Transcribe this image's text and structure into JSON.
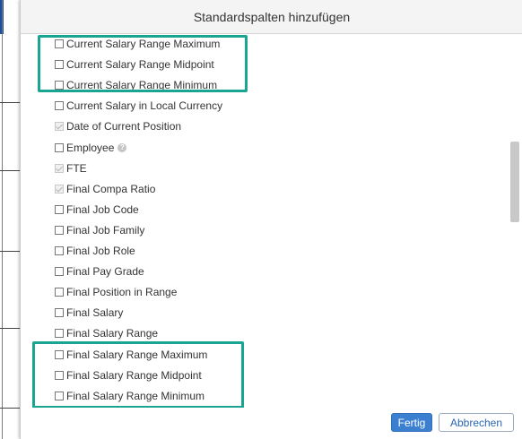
{
  "dialog": {
    "title": "Standardspalten hinzufügen"
  },
  "items": [
    {
      "label": "Current Salary Range Maximum",
      "checked": false,
      "disabled": false
    },
    {
      "label": "Current Salary Range Midpoint",
      "checked": false,
      "disabled": false
    },
    {
      "label": "Current Salary Range Minimum",
      "checked": false,
      "disabled": false
    },
    {
      "label": "Current Salary in Local Currency",
      "checked": false,
      "disabled": false
    },
    {
      "label": "Date of Current Position",
      "checked": true,
      "disabled": true
    },
    {
      "label": "Employee",
      "checked": false,
      "disabled": false,
      "info": true
    },
    {
      "label": "FTE",
      "checked": true,
      "disabled": true
    },
    {
      "label": "Final Compa Ratio",
      "checked": true,
      "disabled": true
    },
    {
      "label": "Final Job Code",
      "checked": false,
      "disabled": false
    },
    {
      "label": "Final Job Family",
      "checked": false,
      "disabled": false
    },
    {
      "label": "Final Job Role",
      "checked": false,
      "disabled": false
    },
    {
      "label": "Final Pay Grade",
      "checked": false,
      "disabled": false
    },
    {
      "label": "Final Position in Range",
      "checked": false,
      "disabled": false
    },
    {
      "label": "Final Salary",
      "checked": false,
      "disabled": false
    },
    {
      "label": "Final Salary Range",
      "checked": false,
      "disabled": false
    },
    {
      "label": "Final Salary Range Maximum",
      "checked": false,
      "disabled": false
    },
    {
      "label": "Final Salary Range Midpoint",
      "checked": false,
      "disabled": false
    },
    {
      "label": "Final Salary Range Minimum",
      "checked": false,
      "disabled": false
    }
  ],
  "footer": {
    "done_label": "Fertig",
    "cancel_label": "Abbrechen"
  },
  "colors": {
    "highlight": "#1aa592",
    "primary": "#3b7fd0"
  }
}
